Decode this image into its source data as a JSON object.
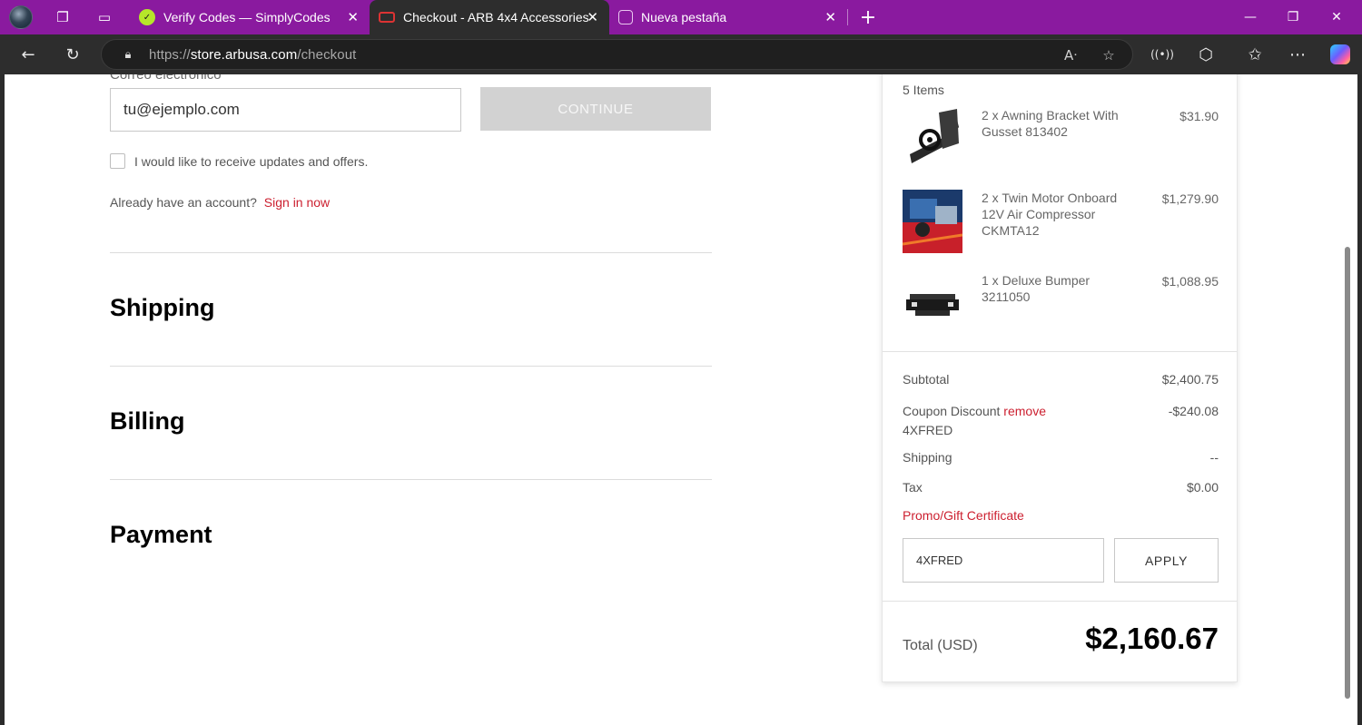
{
  "browser": {
    "tabs": [
      {
        "title": "Verify Codes — SimplyCodes"
      },
      {
        "title": "Checkout - ARB 4x4 Accessories"
      },
      {
        "title": "Nueva pestaña"
      }
    ],
    "url": {
      "prefix": "https://",
      "host": "store.arbusa.com",
      "path": "/checkout"
    },
    "colors": {
      "tabbar": "#8a1a9f",
      "toolbar": "#2d2d2d"
    }
  },
  "customer": {
    "email_label": "Correo electrónico",
    "email_value": "tu@ejemplo.com",
    "continue_label": "CONTINUE",
    "updates_label": "I would like to receive updates and offers.",
    "account_prompt": "Already have an account?",
    "signin_label": "Sign in now"
  },
  "sections": {
    "shipping": "Shipping",
    "billing": "Billing",
    "payment": "Payment"
  },
  "summary": {
    "items_count": "5 Items",
    "items": [
      {
        "name": "2 x Awning Bracket With Gusset 813402",
        "price": "$31.90"
      },
      {
        "name": "2 x Twin Motor Onboard 12V Air Compressor CKMTA12",
        "price": "$1,279.90"
      },
      {
        "name": "1 x Deluxe Bumper 3211050",
        "price": "$1,088.95"
      }
    ],
    "subtotal_label": "Subtotal",
    "subtotal_value": "$2,400.75",
    "coupon_label": "Coupon Discount",
    "coupon_remove": "remove",
    "coupon_code": "4XFRED",
    "coupon_value": "-$240.08",
    "shipping_label": "Shipping",
    "shipping_value": "--",
    "tax_label": "Tax",
    "tax_value": "$0.00",
    "promo_label": "Promo/Gift Certificate",
    "promo_value": "4XFRED",
    "apply_label": "APPLY",
    "total_label": "Total (USD)",
    "total_value": "$2,160.67",
    "accent_color": "#cc1f2f"
  }
}
